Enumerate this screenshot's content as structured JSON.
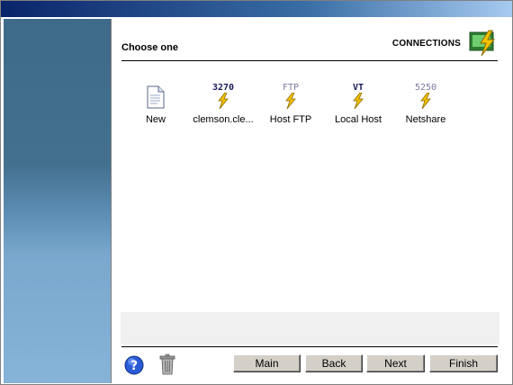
{
  "header": {
    "section_title": "Choose one",
    "brand_label": "CONNECTIONS"
  },
  "connections": [
    {
      "label": "New",
      "icon": "new-document-icon",
      "code": ""
    },
    {
      "label": "clemson.cle...",
      "icon": "terminal-3270-icon",
      "code": "3270"
    },
    {
      "label": "Host FTP",
      "icon": "ftp-icon",
      "code": "FTP"
    },
    {
      "label": "Local Host",
      "icon": "vt-terminal-icon",
      "code": "VT"
    },
    {
      "label": "Netshare",
      "icon": "terminal-5250-icon",
      "code": "5250"
    }
  ],
  "buttons": {
    "main": "Main",
    "back": "Back",
    "next": "Next",
    "finish": "Finish"
  },
  "colors": {
    "titlebar_start": "#0a246a",
    "sidebar": "#44708f",
    "bolt": "#f2c200"
  }
}
